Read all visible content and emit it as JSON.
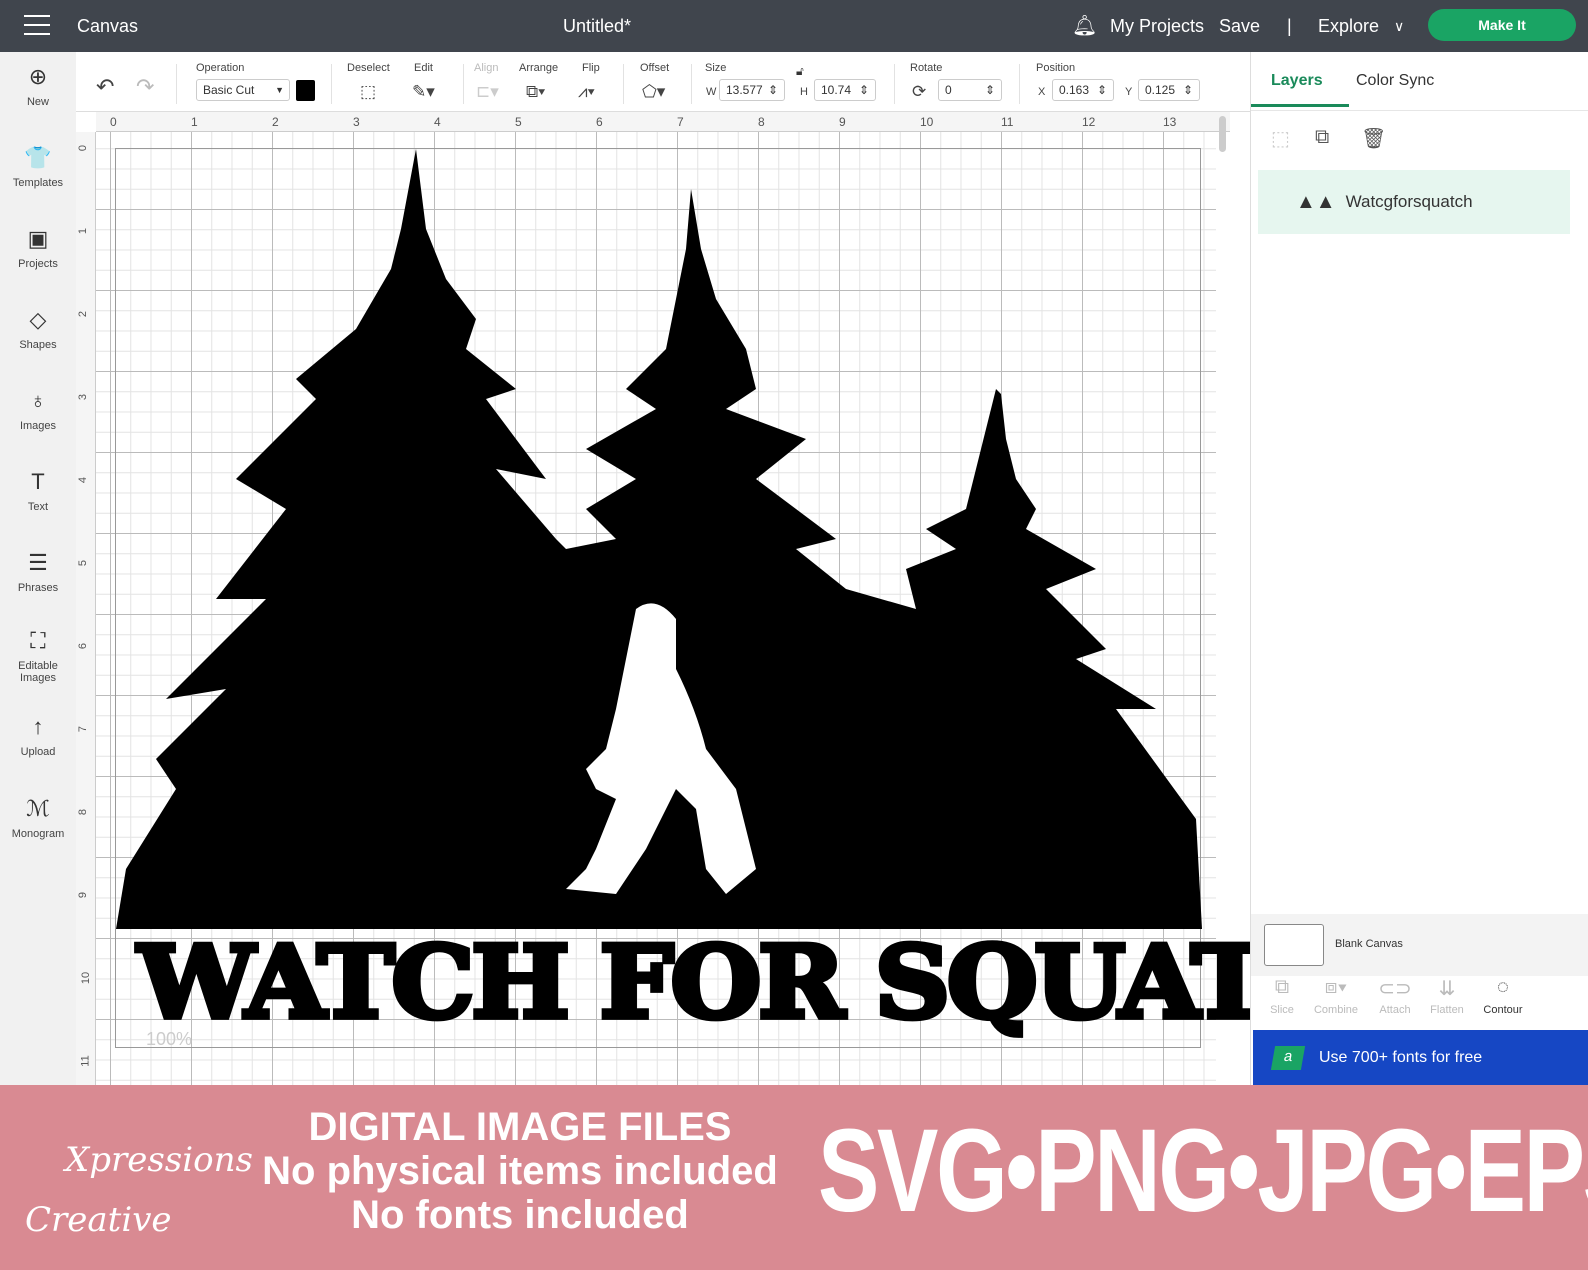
{
  "topbar": {
    "app": "Canvas",
    "title": "Untitled*",
    "my_projects": "My Projects",
    "save": "Save",
    "separator": "|",
    "explore": "Explore",
    "make_it": "Make It"
  },
  "sidebar": [
    {
      "label": "New",
      "icon": "plus-circle-icon",
      "glyph": "⊕"
    },
    {
      "label": "Templates",
      "icon": "shirt-icon",
      "glyph": "👕"
    },
    {
      "label": "Projects",
      "icon": "projects-icon",
      "glyph": "▣"
    },
    {
      "label": "Shapes",
      "icon": "shapes-icon",
      "glyph": "◇"
    },
    {
      "label": "Images",
      "icon": "bulb-icon",
      "glyph": "♁"
    },
    {
      "label": "Text",
      "icon": "text-icon",
      "glyph": "T"
    },
    {
      "label": "Phrases",
      "icon": "phrases-icon",
      "glyph": "☰"
    },
    {
      "label": "Editable",
      "label2": "Images",
      "icon": "editable-images-icon",
      "glyph": "⛶"
    },
    {
      "label": "Upload",
      "icon": "upload-icon",
      "glyph": "↑"
    },
    {
      "label": "Monogram",
      "icon": "monogram-icon",
      "glyph": "ℳ"
    }
  ],
  "toolbar": {
    "operation_label": "Operation",
    "operation_value": "Basic Cut",
    "deselect": "Deselect",
    "edit": "Edit",
    "align": "Align",
    "arrange": "Arrange",
    "flip": "Flip",
    "offset": "Offset",
    "size": "Size",
    "w_label": "W",
    "w_value": "13.577",
    "h_label": "H",
    "h_value": "10.74",
    "rotate": "Rotate",
    "rotate_value": "0",
    "position": "Position",
    "x_label": "X",
    "x_value": "0.163",
    "y_label": "Y",
    "y_value": "0.125",
    "color": "#000000"
  },
  "ruler": {
    "top": [
      "0",
      "1",
      "2",
      "3",
      "4",
      "5",
      "6",
      "7",
      "8",
      "9",
      "10",
      "11",
      "12",
      "13"
    ],
    "left": [
      "0",
      "1",
      "2",
      "3",
      "4",
      "5",
      "6",
      "7",
      "8",
      "9",
      "10",
      "11"
    ]
  },
  "canvas": {
    "design_text": "WATCH FOR SQUATCH",
    "zoom": "100%"
  },
  "panel": {
    "tabs": [
      "Layers",
      "Color Sync"
    ],
    "layer_name": "Watcgforsquatch",
    "blank_canvas": "Blank Canvas",
    "actions": [
      "Slice",
      "Combine",
      "Attach",
      "Flatten",
      "Contour"
    ],
    "promo": "Use 700+ fonts for free",
    "promo_badge": "a"
  },
  "banner": {
    "logo_line1": "Xpressions",
    "logo_line2": "Creative",
    "line1": "DIGITAL IMAGE FILES",
    "line2": "No physical items included",
    "line3": "No fonts included",
    "formats": "SVG•PNG•JPG•EPS",
    "bg": "#d98a92"
  }
}
